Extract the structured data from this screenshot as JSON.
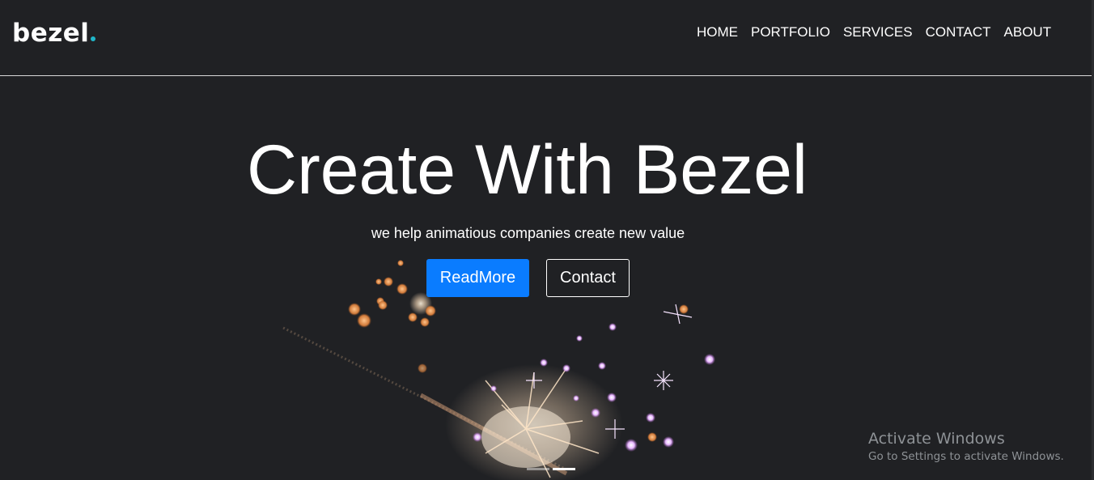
{
  "brand": {
    "name": "bezel",
    "accent_color": "#1fb6c9"
  },
  "nav": {
    "items": [
      {
        "label": "HOME"
      },
      {
        "label": "PORTFOLIO"
      },
      {
        "label": "SERVICES"
      },
      {
        "label": "CONTACT"
      },
      {
        "label": "ABOUT"
      }
    ]
  },
  "hero": {
    "title": "Create With Bezel",
    "subtitle": "we help animatious companies create new value",
    "primary_button": {
      "label": "ReadMore",
      "color": "#0a7cff"
    },
    "secondary_button": {
      "label": "Contact"
    },
    "background_icon": "sparkler-image",
    "carousel": {
      "slides": 2,
      "active_index": 1
    }
  },
  "os_watermark": {
    "title": "Activate Windows",
    "subtitle": "Go to Settings to activate Windows."
  },
  "colors": {
    "background": "#202124",
    "text": "#ffffff",
    "divider": "#d9d9d9"
  }
}
